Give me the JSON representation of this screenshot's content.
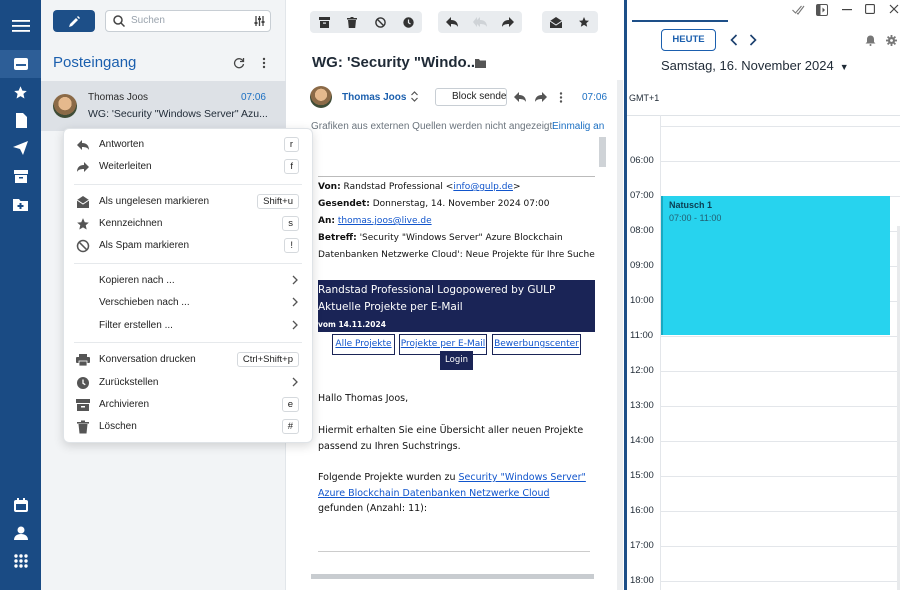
{
  "search": {
    "placeholder": "Suchen"
  },
  "folder": {
    "title": "Posteingang"
  },
  "mail_item": {
    "sender": "Thomas Joos",
    "time": "07:06",
    "subject": "WG: 'Security \"Windows Server\" Azu..."
  },
  "context_menu": {
    "items": [
      {
        "label": "Antworten",
        "shortcut": "r"
      },
      {
        "label": "Weiterleiten",
        "shortcut": "f"
      },
      {
        "label": "Als ungelesen markieren",
        "shortcut": "Shift+u"
      },
      {
        "label": "Kennzeichnen",
        "shortcut": "s"
      },
      {
        "label": "Als Spam markieren",
        "shortcut": "!"
      },
      {
        "label": "Kopieren nach ..."
      },
      {
        "label": "Verschieben nach ..."
      },
      {
        "label": "Filter erstellen ..."
      },
      {
        "label": "Konversation drucken",
        "shortcut": "Ctrl+Shift+p"
      },
      {
        "label": "Zurückstellen"
      },
      {
        "label": "Archivieren",
        "shortcut": "e"
      },
      {
        "label": "Löschen",
        "shortcut": "#"
      }
    ]
  },
  "reader": {
    "subject": "WG: 'Security \"Windo...",
    "from_name": "Thomas Joos",
    "block_label": "Block sender",
    "time": "07:06",
    "image_notice": "Grafiken aus externen Quellen werden nicht angezeigt.",
    "image_load": "Einmalig an",
    "header": {
      "from_label": "Von:",
      "from_value": "Randstad Professional <",
      "from_email": "info@gulp.de",
      "from_end": ">",
      "sent_label": "Gesendet:",
      "sent_value": "Donnerstag, 14. November 2024 07:00",
      "to_label": "An:",
      "to_value": "thomas.joos@live.de",
      "subject_label": "Betreff:",
      "subject_line1": "'Security \"Windows Server\" Azure Blockchain",
      "subject_line2": "Datenbanken Netzwerke Cloud': Neue Projekte für Ihre Suche"
    },
    "banner": {
      "line1": "Randstad Professional Logopowered by  GULP",
      "line2": "Aktuelle Projekte per E-Mail",
      "line3": "vom 14.11.2024"
    },
    "nav_buttons": [
      "Alle Projekte",
      "Projekte per E-Mail",
      "Bewerbungscenter"
    ],
    "login": "Login",
    "greeting": "Hallo Thomas Joos,",
    "intro": "Hiermit erhalten Sie eine Übersicht aller neuen Projekte passend zu Ihren Suchstrings.",
    "found_prefix": "Folgende Projekte wurden zu ",
    "found_link": "Security \"Windows Server\" Azure Blockchain Datenbanken Netzwerke Cloud",
    "found_suffix": " gefunden (Anzahl: 11):"
  },
  "calendar": {
    "today_button": "HEUTE",
    "date": "Samstag, 16. November 2024",
    "timezone": "GMT+1",
    "hours": [
      "06:00",
      "07:00",
      "08:00",
      "09:00",
      "10:00",
      "11:00",
      "12:00",
      "13:00",
      "14:00",
      "15:00",
      "16:00",
      "17:00",
      "18:00"
    ],
    "event": {
      "title": "Natusch 1",
      "range": "07:00 - 11:00",
      "color": "#27d3ee"
    }
  },
  "colors": {
    "rail": "#1a4b84",
    "accent": "#1b5fae",
    "event": "#27d3ee"
  }
}
